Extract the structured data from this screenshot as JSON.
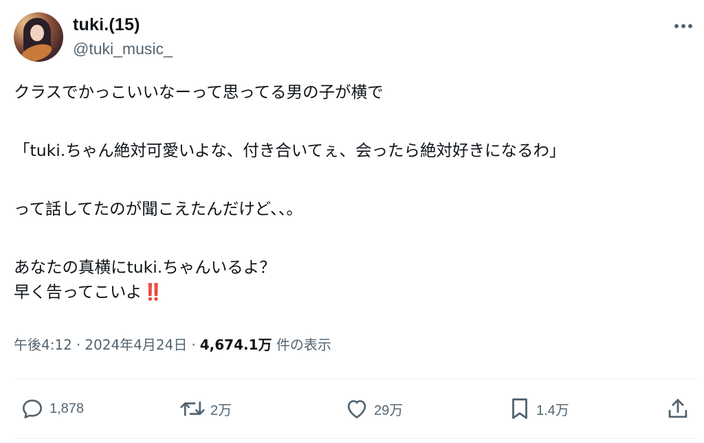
{
  "author": {
    "display_name": "tuki.(15)",
    "handle": "@tuki_music_"
  },
  "post": {
    "lines": [
      "クラスでかっこいいなーって思ってる男の子が横で",
      "「tuki.ちゃん絶対可愛いよな、付き合いてぇ、会ったら絶対好きになるわ」",
      "って話してたのが聞こえたんだけど、、。",
      "あなたの真横にtuki.ちゃんいるよ？",
      "早く告ってこいよ"
    ],
    "emoji": "‼️"
  },
  "meta": {
    "time": "午後4:12",
    "separator": "·",
    "date": "2024年4月24日",
    "views_count": "4,674.1万",
    "views_label": "件の表示"
  },
  "actions": {
    "replies": "1,878",
    "reposts": "2万",
    "likes": "29万",
    "bookmarks": "1.4万"
  },
  "icons": {
    "more": "more-icon",
    "reply": "reply-icon",
    "repost": "repost-icon",
    "like": "heart-icon",
    "bookmark": "bookmark-icon",
    "share": "share-icon"
  },
  "colors": {
    "text_primary": "#0f1419",
    "text_secondary": "#536471",
    "divider": "#eff3f4",
    "emoji_red": "#d3203a"
  }
}
